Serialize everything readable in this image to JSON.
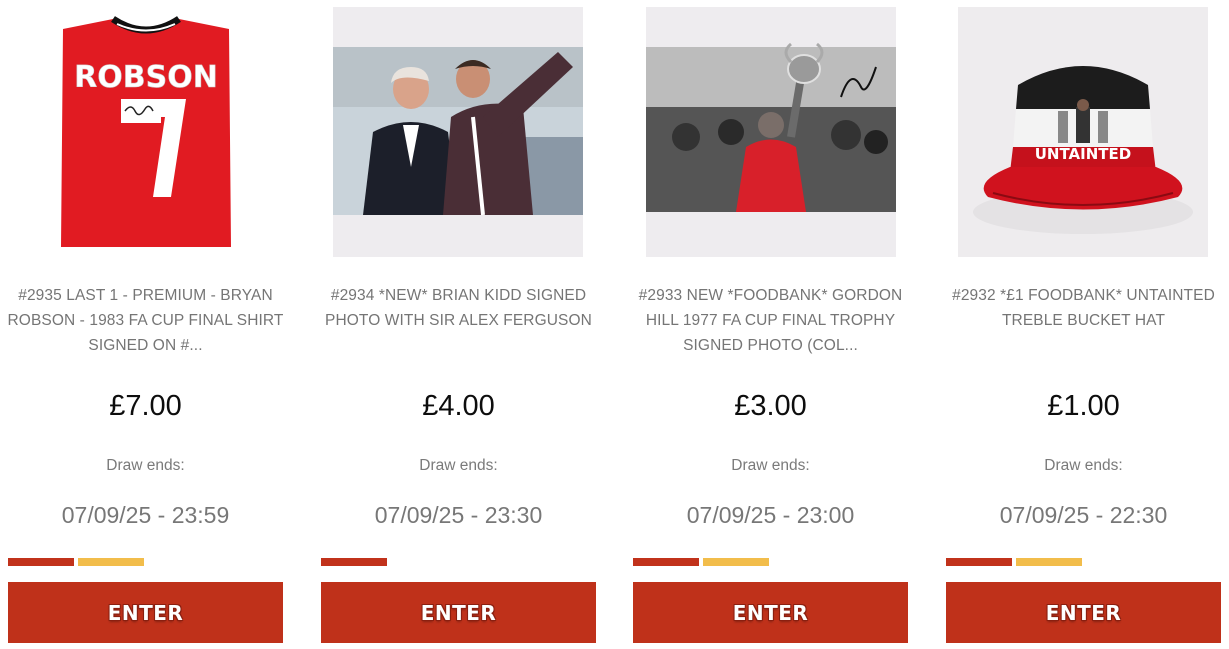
{
  "colors": {
    "accent_red": "#bf311a",
    "progress_red": "#c1321b",
    "progress_yellow": "#f2bd4b",
    "title_grey": "#757575"
  },
  "competitions": [
    {
      "title": "#2935 LAST 1 - PREMIUM - BRYAN ROBSON - 1983 FA CUP FINAL SHIRT SIGNED ON #...",
      "image_alt": "Red signed Robson 7 shirt",
      "shirt_name": "ROBSON",
      "shirt_number": "7",
      "price": "£7.00",
      "draw_label": "Draw ends:",
      "draw_date": "07/09/25 - 23:59",
      "progress_segments": 2,
      "enter_label": "ENTER"
    },
    {
      "title": "#2934 *NEW* BRIAN KIDD SIGNED PHOTO WITH SIR ALEX FERGUSON",
      "image_alt": "Signed photo of two men on touchline",
      "price": "£4.00",
      "draw_label": "Draw ends:",
      "draw_date": "07/09/25 - 23:30",
      "progress_segments": 1,
      "enter_label": "ENTER"
    },
    {
      "title": "#2933 NEW *FOODBANK* GORDON HILL 1977 FA CUP FINAL TROPHY SIGNED PHOTO (COL...",
      "image_alt": "Black and white signed trophy photo",
      "price": "£3.00",
      "draw_label": "Draw ends:",
      "draw_date": "07/09/25 - 23:00",
      "progress_segments": 2,
      "enter_label": "ENTER"
    },
    {
      "title": "#2932 *£1 FOODBANK* UNTAINTED TREBLE BUCKET HAT",
      "image_alt": "Red and white bucket hat",
      "hat_text": "UNTAINTED",
      "price": "£1.00",
      "draw_label": "Draw ends:",
      "draw_date": "07/09/25 - 22:30",
      "progress_segments": 2,
      "enter_label": "ENTER"
    }
  ]
}
